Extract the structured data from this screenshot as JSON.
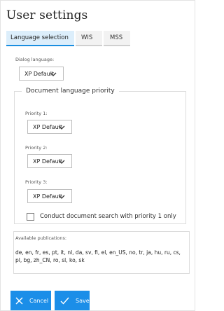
{
  "title": "User settings",
  "tabs": [
    {
      "label": "Language selection",
      "active": true
    },
    {
      "label": "WIS",
      "active": false
    },
    {
      "label": "MSS",
      "active": false
    }
  ],
  "dialog_language": {
    "label": "Dialog language:",
    "value": "XP Default"
  },
  "document_priority": {
    "legend": "Document language priority",
    "priorities": [
      {
        "label": "Priority 1:",
        "value": "XP Default"
      },
      {
        "label": "Priority 2:",
        "value": "XP Default"
      },
      {
        "label": "Priority 3:",
        "value": "XP Default"
      }
    ],
    "checkbox_label": "Conduct document search with priority 1 only",
    "checkbox_checked": false
  },
  "publications": {
    "label": "Available publications:",
    "text": "de, en, fr, es, pt, it, nl, da, sv, fi, el, en_US, no, tr, ja, hu, ru, cs, pl, bg, zh_CN, ro, sl, ko, sk"
  },
  "buttons": {
    "cancel": "Cancel",
    "save": "Save"
  },
  "colors": {
    "accent": "#1b8ee8",
    "tab_active_bg": "#dceefb"
  },
  "icons": {
    "cancel": "close-icon",
    "save": "checkmark-icon",
    "dropdown": "chevron-down-icon"
  }
}
